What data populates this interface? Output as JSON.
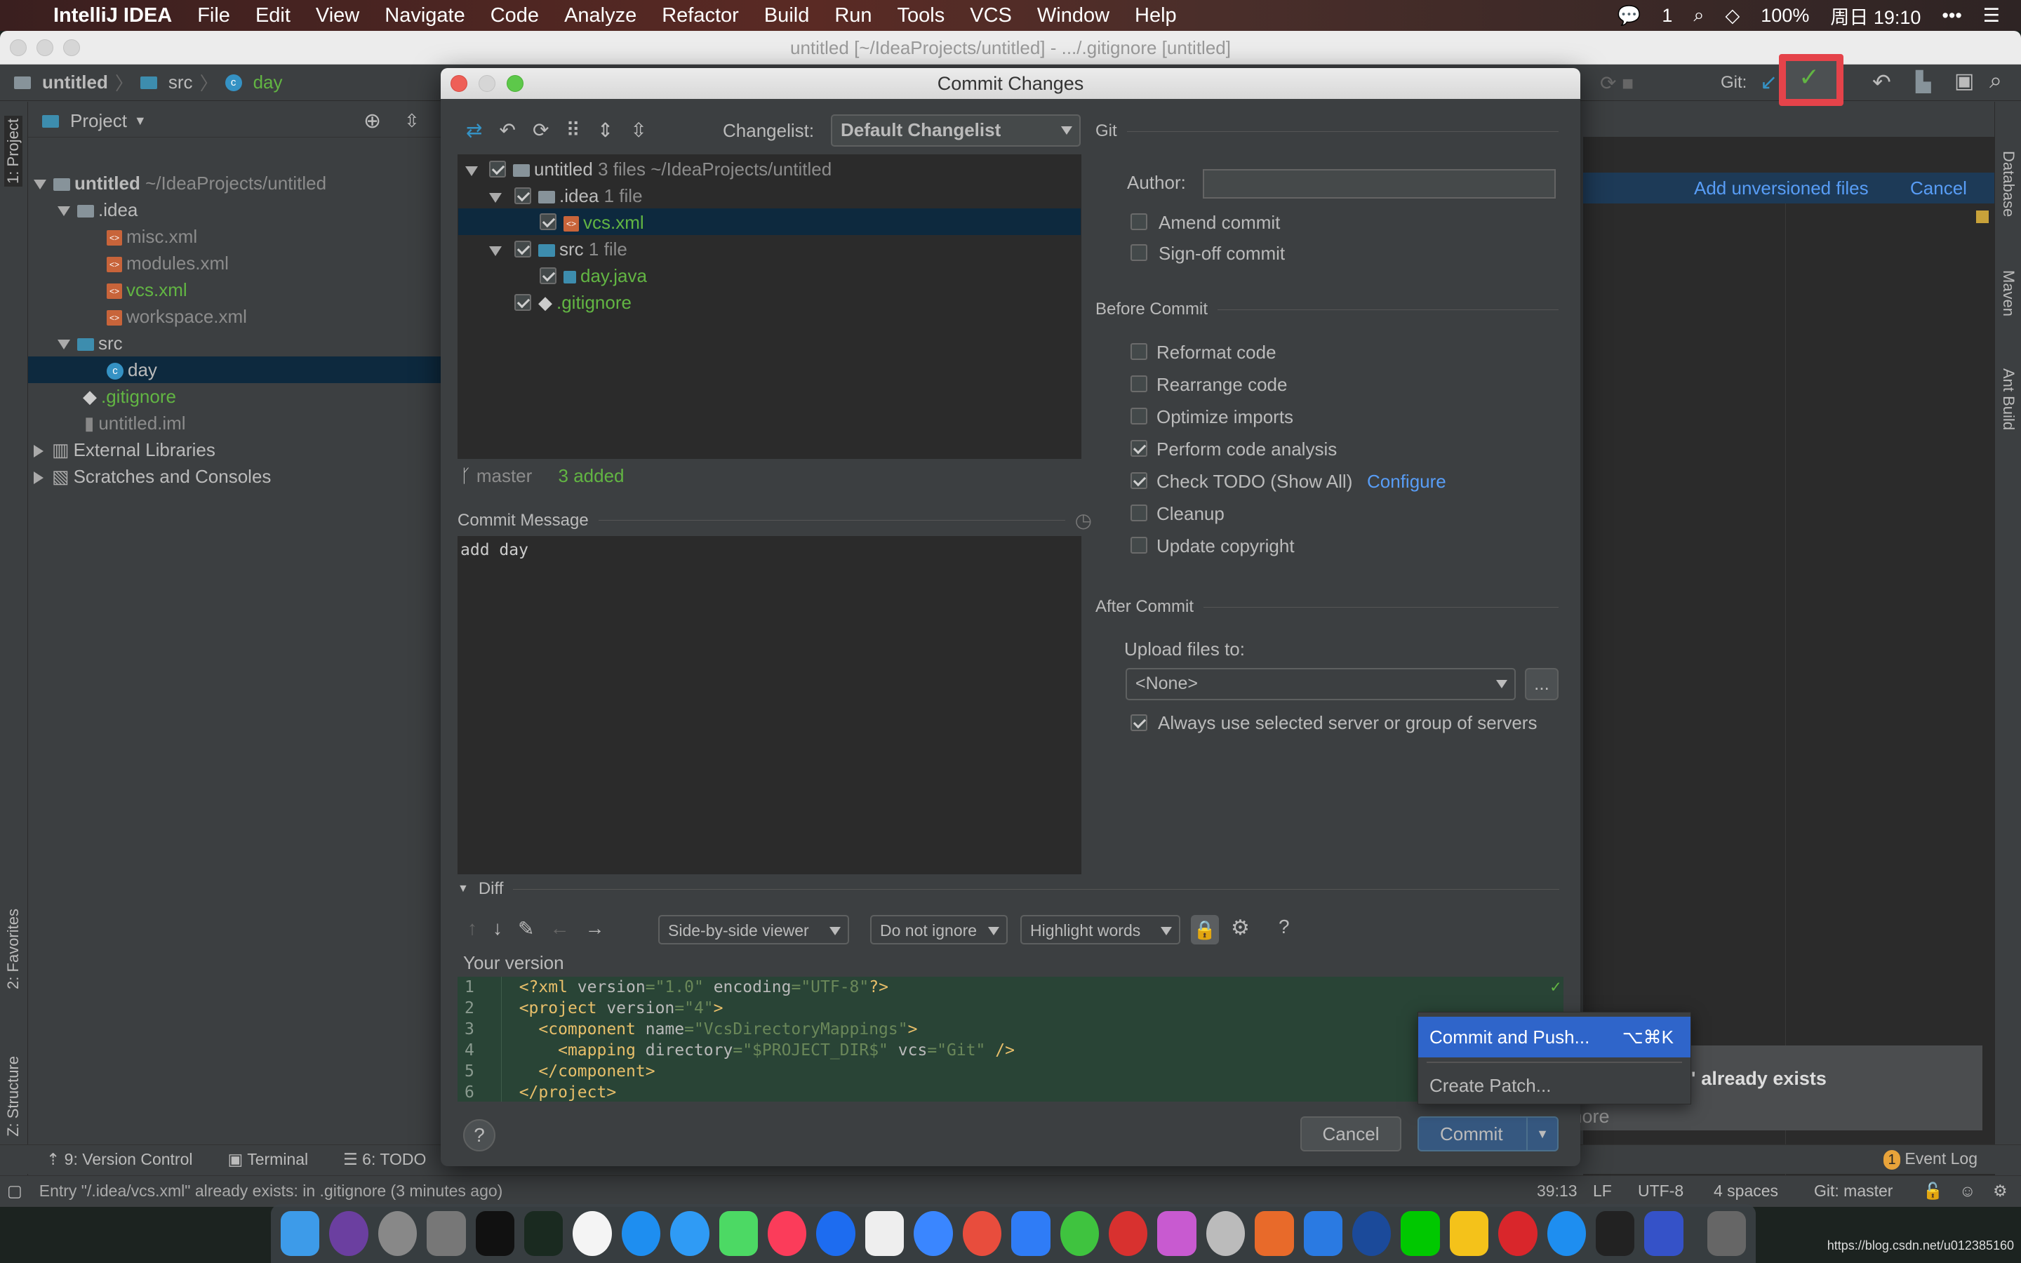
{
  "menubar": {
    "app": "IntelliJ IDEA",
    "items": [
      "File",
      "Edit",
      "View",
      "Navigate",
      "Code",
      "Analyze",
      "Refactor",
      "Build",
      "Run",
      "Tools",
      "VCS",
      "Window",
      "Help"
    ],
    "battery": "100%",
    "clock": "周日 19:10",
    "badge": "1"
  },
  "window": {
    "title": "untitled [~/IdeaProjects/untitled] - .../.gitignore [untitled]"
  },
  "breadcrumb": [
    "untitled",
    "src",
    "day"
  ],
  "toolbar": {
    "git_label": "Git:"
  },
  "left_strip": {
    "project": "1: Project",
    "favorites": "2: Favorites",
    "structure": "Z: Structure"
  },
  "right_strip": {
    "database": "Database",
    "maven": "Maven",
    "ant": "Ant Build"
  },
  "project": {
    "header": "Project",
    "tree": [
      {
        "label": "untitled",
        "hint": "~/IdeaProjects/untitled",
        "type": "module"
      },
      {
        "label": ".idea",
        "type": "folder"
      },
      {
        "label": "misc.xml",
        "type": "xml"
      },
      {
        "label": "modules.xml",
        "type": "xml"
      },
      {
        "label": "vcs.xml",
        "type": "xml",
        "status": "added"
      },
      {
        "label": "workspace.xml",
        "type": "xml"
      },
      {
        "label": "src",
        "type": "folder"
      },
      {
        "label": "day",
        "type": "class",
        "selected": true
      },
      {
        "label": ".gitignore",
        "type": "git",
        "status": "added"
      },
      {
        "label": "untitled.iml",
        "type": "iml"
      },
      {
        "label": "External Libraries",
        "type": "lib"
      },
      {
        "label": "Scratches and Consoles",
        "type": "scratch"
      }
    ]
  },
  "editor": {
    "banner_add": "Add unversioned files",
    "banner_cancel": "Cancel"
  },
  "notification": {
    "title_fragment": "nl\" already exists",
    "more": "more"
  },
  "dialog": {
    "title": "Commit Changes",
    "changelist_label": "Changelist:",
    "changelist_value": "Default Changelist",
    "changes": [
      {
        "label": "untitled",
        "count": "3 files",
        "hint": "~/IdeaProjects/untitled"
      },
      {
        "label": ".idea",
        "count": "1 file"
      },
      {
        "label": "vcs.xml"
      },
      {
        "label": "src",
        "count": "1 file"
      },
      {
        "label": "day.java"
      },
      {
        "label": ".gitignore"
      }
    ],
    "branch": "master",
    "added": "3 added",
    "commit_message_label": "Commit Message",
    "commit_message": "add day",
    "git_section": "Git",
    "author_label": "Author:",
    "author_value": "",
    "amend": "Amend commit",
    "signoff": "Sign-off commit",
    "before_commit": "Before Commit",
    "before_options": [
      {
        "label": "Reformat code",
        "checked": false
      },
      {
        "label": "Rearrange code",
        "checked": false
      },
      {
        "label": "Optimize imports",
        "checked": false
      },
      {
        "label": "Perform code analysis",
        "checked": true
      },
      {
        "label": "Check TODO (Show All)",
        "checked": true,
        "link": "Configure"
      },
      {
        "label": "Cleanup",
        "checked": false
      },
      {
        "label": "Update copyright",
        "checked": false
      }
    ],
    "after_commit": "After Commit",
    "upload_label": "Upload files to:",
    "upload_value": "<None>",
    "browse": "...",
    "always_use": "Always use selected server or group of servers",
    "diff_label": "Diff",
    "viewer": "Side-by-side viewer",
    "ignore": "Do not ignore",
    "highlight": "Highlight words",
    "your_version": "Your version",
    "help": "?",
    "cancel": "Cancel",
    "commit": "Commit"
  },
  "popup": {
    "commit_push": "Commit and Push...",
    "shortcut": "⌥⌘K",
    "create_patch": "Create Patch..."
  },
  "toolwindows": {
    "vc": "9: Version Control",
    "terminal": "Terminal",
    "todo": "6: TODO",
    "event_log": "Event Log",
    "event_count": "1"
  },
  "status": {
    "message": "Entry \"/.idea/vcs.xml\" already exists: in .gitignore (3 minutes ago)",
    "position": "39:13",
    "line_sep": "LF",
    "encoding": "UTF-8",
    "indent": "4 spaces",
    "branch": "Git: master"
  },
  "watermark": "https://blog.csdn.net/u012385160",
  "colors": {
    "accent": "#2f65ca",
    "added": "#62b543",
    "link": "#589df6",
    "highlight_box": "#e5434a"
  }
}
